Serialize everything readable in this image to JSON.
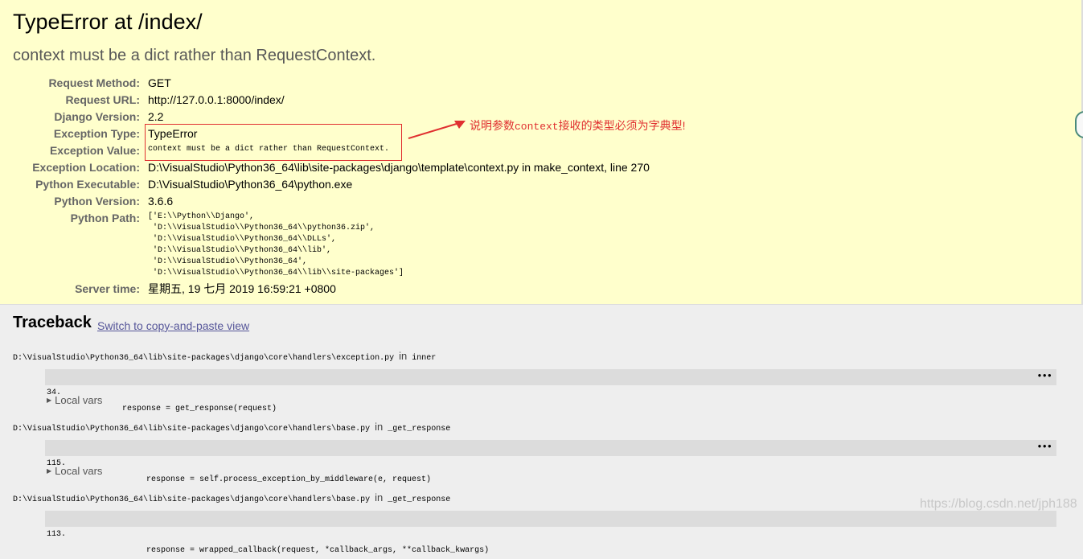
{
  "summary": {
    "title": "TypeError at /index/",
    "subtitle": "context must be a dict rather than RequestContext.",
    "rows": [
      {
        "label": "Request Method:",
        "value": "GET"
      },
      {
        "label": "Request URL:",
        "value": "http://127.0.0.1:8000/index/"
      },
      {
        "label": "Django Version:",
        "value": "2.2"
      },
      {
        "label": "Exception Type:",
        "value": "TypeError"
      },
      {
        "label": "Exception Value:",
        "value": "context must be a dict rather than RequestContext."
      },
      {
        "label": "Exception Location:",
        "value": "D:\\VisualStudio\\Python36_64\\lib\\site-packages\\django\\template\\context.py in make_context, line 270"
      },
      {
        "label": "Python Executable:",
        "value": "D:\\VisualStudio\\Python36_64\\python.exe"
      },
      {
        "label": "Python Version:",
        "value": "3.6.6"
      },
      {
        "label": "Python Path:",
        "value": "['E:\\\\Python\\\\Django',\n 'D:\\\\VisualStudio\\\\Python36_64\\\\python36.zip',\n 'D:\\\\VisualStudio\\\\Python36_64\\\\DLLs',\n 'D:\\\\VisualStudio\\\\Python36_64\\\\lib',\n 'D:\\\\VisualStudio\\\\Python36_64',\n 'D:\\\\VisualStudio\\\\Python36_64\\\\lib\\\\site-packages']"
      },
      {
        "label": "Server time:",
        "value": "星期五, 19 七月 2019 16:59:21 +0800"
      }
    ]
  },
  "annotation": {
    "text_before": "说明参数",
    "text_mono": "context",
    "text_after": "接收的类型必须为字典型!",
    "color": "#e03030"
  },
  "traceback": {
    "heading": "Traceback",
    "switch_link": "Switch to copy-and-paste view",
    "in_word": "in",
    "local_vars_label": "Local vars",
    "frames": [
      {
        "path": "D:\\VisualStudio\\Python36_64\\lib\\site-packages\\django\\core\\handlers\\exception.py",
        "func": "inner",
        "lineno": "34.",
        "code": "response = get_response(request)"
      },
      {
        "path": "D:\\VisualStudio\\Python36_64\\lib\\site-packages\\django\\core\\handlers\\base.py",
        "func": "_get_response",
        "lineno": "115.",
        "code": "response = self.process_exception_by_middleware(e, request)"
      },
      {
        "path": "D:\\VisualStudio\\Python36_64\\lib\\site-packages\\django\\core\\handlers\\base.py",
        "func": "_get_response",
        "lineno": "113.",
        "code": "response = wrapped_callback(request, *callback_args, **callback_kwargs)"
      }
    ],
    "dots": "•••"
  },
  "watermark": "https://blog.csdn.net/jph188",
  "colors": {
    "summary_bg": "#ffffcc",
    "page_bg": "#eeeeee",
    "link": "#555599",
    "label": "#666666"
  }
}
